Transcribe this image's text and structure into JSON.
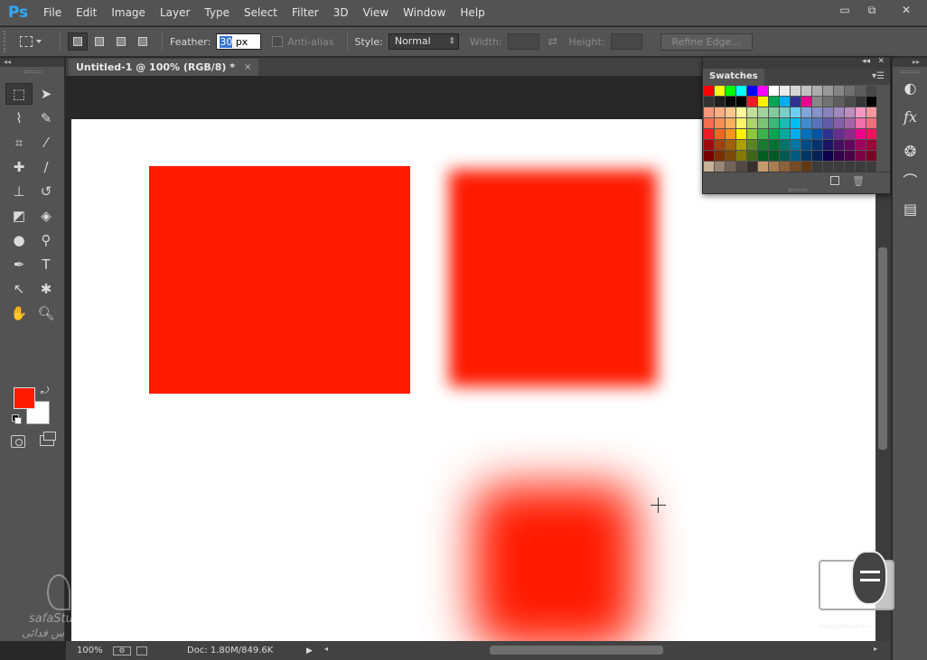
{
  "app": {
    "logo": "Ps"
  },
  "menu": [
    "File",
    "Edit",
    "Image",
    "Layer",
    "Type",
    "Select",
    "Filter",
    "3D",
    "View",
    "Window",
    "Help"
  ],
  "window_controls": {
    "minimize": "▭",
    "restore": "⧉",
    "close": "✕"
  },
  "options": {
    "feather_label": "Feather:",
    "feather_value_selected": "30",
    "feather_unit": " px",
    "antialias_label": "Anti-alias",
    "style_label": "Style:",
    "style_value": "Normal",
    "width_label": "Width:",
    "height_label": "Height:",
    "refine_edge": "Refine Edge..."
  },
  "document": {
    "tab_title": "Untitled-1 @ 100% (RGB/8) *",
    "tab_close": "×"
  },
  "status": {
    "zoom": "100%",
    "doc_info": "Doc: 1.80M/849.6K"
  },
  "colors": {
    "foreground": "#ff1a00",
    "background": "#ffffff"
  },
  "swatches_panel": {
    "title": "Swatches",
    "rows": [
      [
        "#ff0000",
        "#ffff00",
        "#00ff00",
        "#00ffff",
        "#0000ff",
        "#ff00ff",
        "#ffffff",
        "#ebebeb",
        "#d6d6d6",
        "#c2c2c2",
        "#adadad",
        "#999999",
        "#858585",
        "#707070",
        "#5c5c5c",
        "#474747"
      ],
      [
        "#333333",
        "#1f1f1f",
        "#0a0a0a",
        "#000000",
        "#ed1c24",
        "#fff200",
        "#00a651",
        "#00aeef",
        "#2e3192",
        "#ec008c",
        "#878787",
        "#727272",
        "#5e5e5e",
        "#4a4a4a",
        "#363636",
        "#000000"
      ],
      [
        "#f7977a",
        "#f9ad81",
        "#fdc68a",
        "#fff79a",
        "#c4df9b",
        "#a2d39c",
        "#82ca9d",
        "#7bcdc8",
        "#6ecff6",
        "#7ea7d8",
        "#8493ca",
        "#8882be",
        "#a187be",
        "#bc8dbf",
        "#f49ac2",
        "#f6989d"
      ],
      [
        "#f26c4f",
        "#f68e55",
        "#fbaf5d",
        "#fff467",
        "#acd372",
        "#7cc576",
        "#3bb878",
        "#1abbb4",
        "#00bff3",
        "#438ccb",
        "#5574b9",
        "#605ca8",
        "#855fa8",
        "#a763a8",
        "#f06ea9",
        "#f26d7d"
      ],
      [
        "#ed1c24",
        "#f26522",
        "#f7941d",
        "#fff200",
        "#8dc73f",
        "#39b54a",
        "#00a651",
        "#00a99d",
        "#00aeef",
        "#0072bc",
        "#0054a6",
        "#2e3192",
        "#662d91",
        "#92278f",
        "#ec008c",
        "#ed145b"
      ],
      [
        "#9e0b0f",
        "#a0410d",
        "#a36209",
        "#aba000",
        "#598527",
        "#1a7b30",
        "#007236",
        "#00746b",
        "#0076a3",
        "#004b80",
        "#003471",
        "#1b1464",
        "#440e62",
        "#630460",
        "#9e005d",
        "#9e0039"
      ],
      [
        "#790000",
        "#7b2e00",
        "#7d4900",
        "#827b00",
        "#406618",
        "#005e20",
        "#005826",
        "#005952",
        "#005b7f",
        "#003663",
        "#002157",
        "#0d004c",
        "#32004b",
        "#4b0049",
        "#7b0046",
        "#7a0026"
      ],
      [
        "#c7b299",
        "#998675",
        "#736357",
        "#534741",
        "#37302d",
        "#c69c6d",
        "#a67c52",
        "#8c6239",
        "#754c24",
        "#603913",
        "#3c3c3c",
        "#3c3c3c",
        "#3c3c3c",
        "#3c3c3c",
        "#3c3c3c",
        "#3c3c3c"
      ]
    ]
  },
  "watermark": {
    "left_text": "safaStu",
    "left_text_persian": "س فدائی",
    "right_site": "www.farhadhan.ir"
  }
}
